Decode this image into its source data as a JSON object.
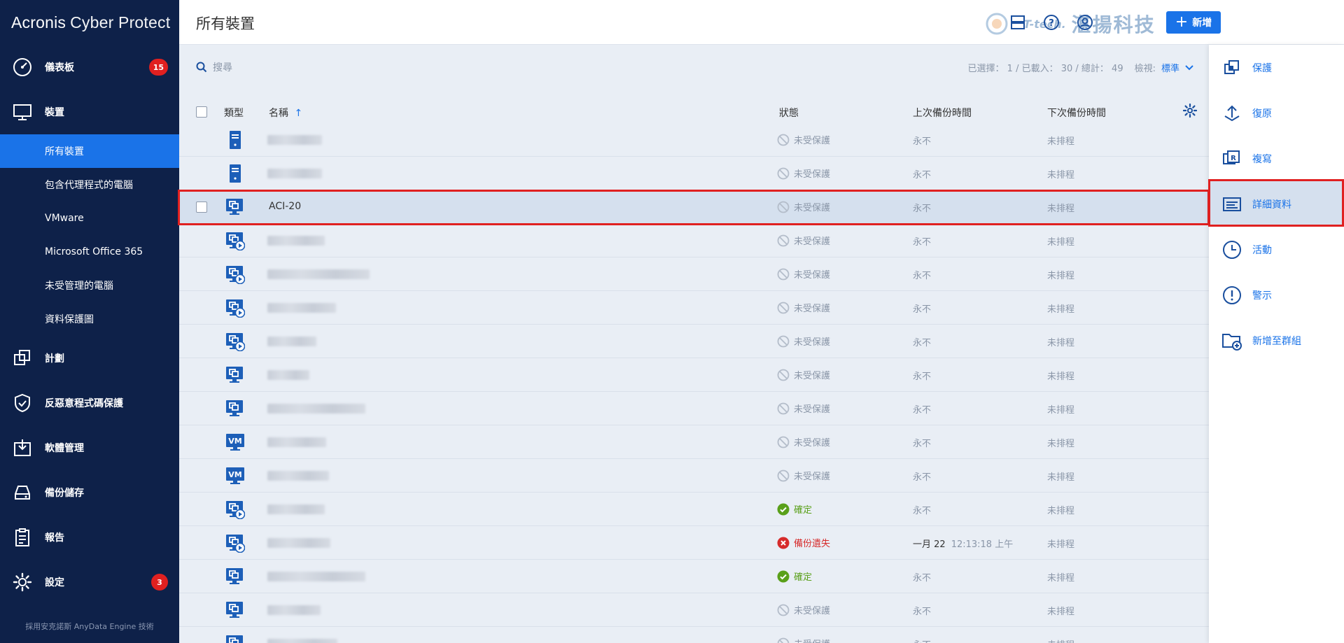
{
  "brand": {
    "name1": "Acronis",
    "name2": "Cyber Protect"
  },
  "sidebar": {
    "items": [
      {
        "label": "儀表板",
        "icon": "dashboard-icon",
        "badge": "15"
      },
      {
        "label": "裝置",
        "icon": "monitor-icon",
        "badge": ""
      }
    ],
    "subitems": [
      {
        "label": "所有裝置",
        "active": true
      },
      {
        "label": "包含代理程式的電腦",
        "active": false
      },
      {
        "label": "VMware",
        "active": false
      },
      {
        "label": "Microsoft Office 365",
        "active": false
      },
      {
        "label": "未受管理的電腦",
        "active": false
      },
      {
        "label": "資料保護圖",
        "active": false
      }
    ],
    "lower": [
      {
        "label": "計劃",
        "icon": "plans-icon",
        "badge": ""
      },
      {
        "label": "反惡意程式碼保護",
        "icon": "shield-icon",
        "badge": ""
      },
      {
        "label": "軟體管理",
        "icon": "software-icon",
        "badge": ""
      },
      {
        "label": "備份儲存",
        "icon": "storage-icon",
        "badge": ""
      },
      {
        "label": "報告",
        "icon": "report-icon",
        "badge": ""
      },
      {
        "label": "設定",
        "icon": "gear-icon",
        "badge": "3"
      }
    ],
    "powered_by": "採用安克諾斯 AnyData Engine 技術"
  },
  "header": {
    "title": "所有裝置",
    "watermark_t": "T-tech.",
    "watermark_cn": "湛揚科技",
    "add_label": "新增"
  },
  "toolbar": {
    "search_placeholder": "搜尋",
    "stats": "已選擇： 1 / 已載入： 30 / 總計： 49",
    "view_label": "檢視:",
    "view_value": "標準"
  },
  "table": {
    "columns": {
      "type": "類型",
      "name": "名稱",
      "status": "狀態",
      "last": "上次備份時間",
      "next": "下次備份時間"
    },
    "rows": [
      {
        "icon": "server",
        "name": "",
        "blur_w": 78,
        "status": "未受保護",
        "status_kind": "none",
        "last": "永不",
        "last_time": "",
        "next": "未排程",
        "selected": false
      },
      {
        "icon": "server",
        "name": "",
        "blur_w": 78,
        "status": "未受保護",
        "status_kind": "none",
        "last": "永不",
        "last_time": "",
        "next": "未排程",
        "selected": false
      },
      {
        "icon": "vm",
        "name": "ACI-20",
        "blur_w": 0,
        "status": "未受保護",
        "status_kind": "none",
        "last": "永不",
        "last_time": "",
        "next": "未排程",
        "selected": true
      },
      {
        "icon": "vmplay",
        "name": "",
        "blur_w": 82,
        "status": "未受保護",
        "status_kind": "none",
        "last": "永不",
        "last_time": "",
        "next": "未排程",
        "selected": false
      },
      {
        "icon": "vmplay",
        "name": "",
        "blur_w": 146,
        "status": "未受保護",
        "status_kind": "none",
        "last": "永不",
        "last_time": "",
        "next": "未排程",
        "selected": false
      },
      {
        "icon": "vmplay",
        "name": "",
        "blur_w": 98,
        "status": "未受保護",
        "status_kind": "none",
        "last": "永不",
        "last_time": "",
        "next": "未排程",
        "selected": false
      },
      {
        "icon": "vmplay",
        "name": "",
        "blur_w": 70,
        "status": "未受保護",
        "status_kind": "none",
        "last": "永不",
        "last_time": "",
        "next": "未排程",
        "selected": false
      },
      {
        "icon": "vm",
        "name": "",
        "blur_w": 60,
        "status": "未受保護",
        "status_kind": "none",
        "last": "永不",
        "last_time": "",
        "next": "未排程",
        "selected": false
      },
      {
        "icon": "vm",
        "name": "",
        "blur_w": 140,
        "status": "未受保護",
        "status_kind": "none",
        "last": "永不",
        "last_time": "",
        "next": "未排程",
        "selected": false
      },
      {
        "icon": "vmtext",
        "name": "",
        "blur_w": 84,
        "status": "未受保護",
        "status_kind": "none",
        "last": "永不",
        "last_time": "",
        "next": "未排程",
        "selected": false
      },
      {
        "icon": "vmtext",
        "name": "",
        "blur_w": 88,
        "status": "未受保護",
        "status_kind": "none",
        "last": "永不",
        "last_time": "",
        "next": "未排程",
        "selected": false
      },
      {
        "icon": "vmplay",
        "name": "",
        "blur_w": 82,
        "status": "確定",
        "status_kind": "ok",
        "last": "永不",
        "last_time": "",
        "next": "未排程",
        "selected": false
      },
      {
        "icon": "vmplay",
        "name": "",
        "blur_w": 90,
        "status": "備份遺失",
        "status_kind": "err",
        "last": "一月 22",
        "last_time": "12:13:18 上午",
        "next": "未排程",
        "selected": false
      },
      {
        "icon": "vm",
        "name": "",
        "blur_w": 140,
        "status": "確定",
        "status_kind": "ok",
        "last": "永不",
        "last_time": "",
        "next": "未排程",
        "selected": false
      },
      {
        "icon": "vm",
        "name": "",
        "blur_w": 76,
        "status": "未受保護",
        "status_kind": "none",
        "last": "永不",
        "last_time": "",
        "next": "未排程",
        "selected": false
      },
      {
        "icon": "vm",
        "name": "",
        "blur_w": 100,
        "status": "未受保護",
        "status_kind": "none",
        "last": "永不",
        "last_time": "",
        "next": "未排程",
        "selected": false
      }
    ]
  },
  "actions": [
    {
      "label": "保護",
      "icon": "protect-icon",
      "active": false
    },
    {
      "label": "復原",
      "icon": "recover-icon",
      "active": false
    },
    {
      "label": "複寫",
      "icon": "replicate-icon",
      "active": false
    },
    {
      "label": "詳細資料",
      "icon": "details-icon",
      "active": true
    },
    {
      "label": "活動",
      "icon": "clock-icon",
      "active": false
    },
    {
      "label": "警示",
      "icon": "alert-icon",
      "active": false
    },
    {
      "label": "新增至群組",
      "icon": "add-folder-icon",
      "active": false
    }
  ],
  "colors": {
    "sidebar": "#0e2149",
    "accent": "#1a73e8",
    "danger": "#e02020",
    "ok": "#5aa01a"
  }
}
